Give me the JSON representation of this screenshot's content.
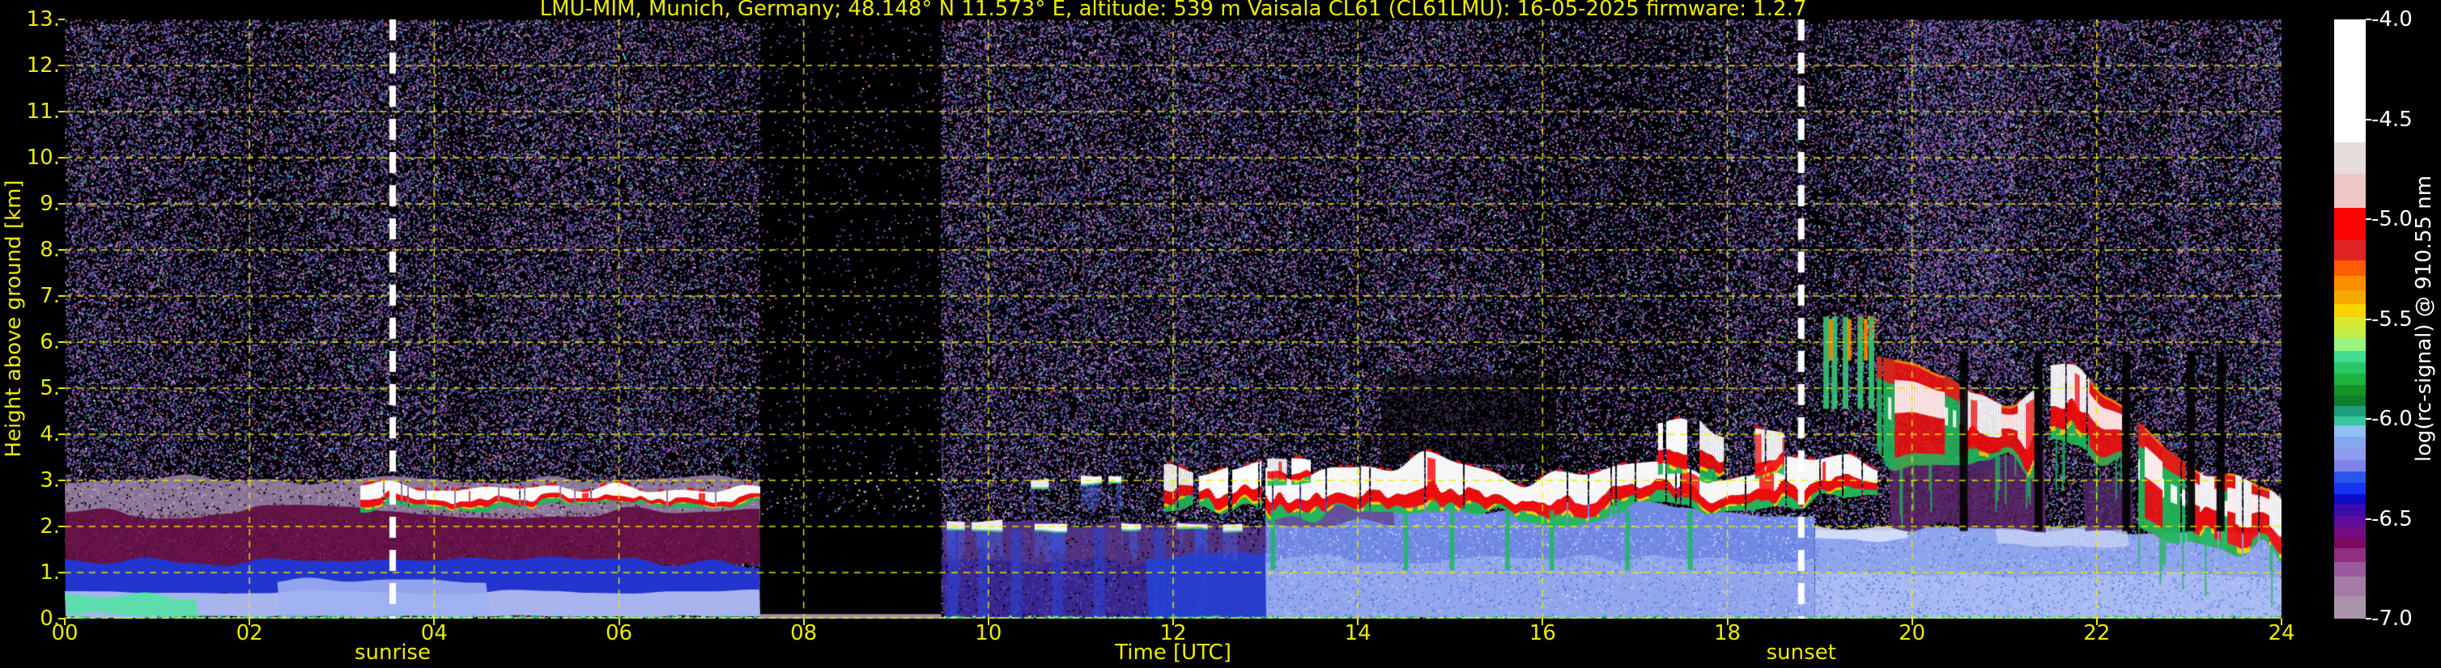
{
  "chart_data": {
    "type": "heatmap",
    "title": "LMU-MIM, Munich, Germany; 48.148° N 11.573° E, altitude: 539 m    Vaisala CL61 (CL61LMU): 16-05-2025    firmware: 1.2.7",
    "xlabel": "Time [UTC]",
    "ylabel": "Height above ground [km]",
    "colorbar_label": "log(rc-signal) @ 910.55 nm",
    "x_range_hours": [
      0,
      24
    ],
    "y_range_km": [
      0,
      13
    ],
    "grid": true,
    "x_ticks": [
      "00",
      "02",
      "04",
      "06",
      "08",
      "10",
      "12",
      "14",
      "16",
      "18",
      "20",
      "22",
      "24"
    ],
    "y_ticks": [
      "0.",
      "1.",
      "2.",
      "3.",
      "4.",
      "5.",
      "6.",
      "7.",
      "8.",
      "9.",
      "10.",
      "11.",
      "12.",
      "13."
    ],
    "colorbar_range": [
      -4.0,
      -7.0
    ],
    "colorbar_ticks": [
      {
        "v": -4.0,
        "label": "-4.0"
      },
      {
        "v": -4.5,
        "label": "-4.5"
      },
      {
        "v": -5.0,
        "label": "-5.0"
      },
      {
        "v": -5.5,
        "label": "-5.5"
      },
      {
        "v": -6.0,
        "label": "-6.0"
      },
      {
        "v": -6.5,
        "label": "-6.5"
      },
      {
        "v": -7.0,
        "label": "-7.0"
      }
    ],
    "colorbar_stops": [
      [
        0.0,
        0.205,
        "#ffffff"
      ],
      [
        0.205,
        0.258,
        "#e7dcdc"
      ],
      [
        0.258,
        0.315,
        "#eec6c6"
      ],
      [
        0.315,
        0.368,
        "#fb0404"
      ],
      [
        0.368,
        0.402,
        "#df2424"
      ],
      [
        0.402,
        0.428,
        "#fd5b04"
      ],
      [
        0.428,
        0.452,
        "#fb8d00"
      ],
      [
        0.452,
        0.475,
        "#f8a802"
      ],
      [
        0.475,
        0.497,
        "#fbd400"
      ],
      [
        0.497,
        0.516,
        "#d9e832"
      ],
      [
        0.516,
        0.532,
        "#c2ee45"
      ],
      [
        0.532,
        0.553,
        "#98f47e"
      ],
      [
        0.553,
        0.572,
        "#43dd92"
      ],
      [
        0.572,
        0.591,
        "#2bc767"
      ],
      [
        0.591,
        0.61,
        "#1cb23b"
      ],
      [
        0.61,
        0.628,
        "#139426"
      ],
      [
        0.628,
        0.645,
        "#0c7e2c"
      ],
      [
        0.645,
        0.662,
        "#1d9d80"
      ],
      [
        0.662,
        0.677,
        "#36c79b"
      ],
      [
        0.677,
        0.697,
        "#8fc1f2"
      ],
      [
        0.697,
        0.716,
        "#84a8f0"
      ],
      [
        0.716,
        0.735,
        "#8f9bee"
      ],
      [
        0.735,
        0.754,
        "#7e83ea"
      ],
      [
        0.754,
        0.773,
        "#2b58e8"
      ],
      [
        0.773,
        0.792,
        "#1635f2"
      ],
      [
        0.792,
        0.81,
        "#0d0dc8"
      ],
      [
        0.81,
        0.828,
        "#3c0cab"
      ],
      [
        0.828,
        0.846,
        "#5c0d9b"
      ],
      [
        0.846,
        0.864,
        "#740c86"
      ],
      [
        0.864,
        0.882,
        "#7c0a62"
      ],
      [
        0.882,
        0.905,
        "#8f2f84"
      ],
      [
        0.905,
        0.93,
        "#9a5a9e"
      ],
      [
        0.93,
        0.962,
        "#a37ca6"
      ],
      [
        0.962,
        1.0,
        "#ab93ab"
      ]
    ],
    "annotations": {
      "sunrise": {
        "label": "sunrise",
        "hour": 3.55
      },
      "sunset": {
        "label": "sunset",
        "hour": 18.8
      }
    },
    "data_gap_hours": [
      7.53,
      9.49
    ],
    "accent_colors": {
      "axis_yellow": "#ebeb00",
      "tick_white": "#ffffff",
      "background": "#000000"
    },
    "palettes": {
      "bg": [
        [
          "#6f4a9e",
          6
        ],
        [
          "#9b76b6",
          5
        ],
        [
          "#4f3a98",
          4
        ],
        [
          "#3a56d2",
          2
        ],
        [
          "#b494d0",
          2
        ],
        [
          "#d06ab2",
          1
        ],
        [
          "#2fb3a2",
          0.6
        ],
        [
          "#45c8e8",
          0.5
        ],
        [
          "#c23a52",
          0.5
        ],
        [
          "#22a050",
          0.5
        ],
        [
          "#e0e0e0",
          0.3
        ]
      ],
      "mauve": [
        [
          "#a890a8",
          5
        ],
        [
          "#8a6f92",
          3
        ],
        [
          "#000000",
          2
        ],
        [
          "#c9b4cc",
          1
        ]
      ],
      "maroon": [
        [
          "#6e1a50",
          4
        ],
        [
          "#4f1038",
          3
        ],
        [
          "#8a2a62",
          2
        ],
        [
          "#3a1030",
          1
        ]
      ],
      "purpleblue": [
        [
          "#4a2f96",
          4
        ],
        [
          "#5c3a8a",
          3
        ],
        [
          "#2a46d8",
          2
        ],
        [
          "#000000",
          1.5
        ],
        [
          "#7a55aa",
          1
        ]
      ],
      "blues": [
        [
          "#8fa5ec",
          4
        ],
        [
          "#6f8ae6",
          3
        ],
        [
          "#aabbf2",
          2
        ],
        [
          "#5570dd",
          1.5
        ],
        [
          "#c8d4f8",
          1
        ]
      ],
      "white": [
        [
          "#ffffff",
          1
        ]
      ],
      "warm": [
        [
          "#fc8c00",
          3
        ],
        [
          "#fb3a00",
          2
        ],
        [
          "#fcd200",
          1
        ]
      ]
    },
    "scene": [
      {
        "type": "noise",
        "t": [
          0,
          24
        ],
        "h": [
          0,
          13
        ],
        "d": 0.42,
        "pal": "bg",
        "s": 1
      },
      {
        "type": "wband",
        "t": [
          0,
          7.53
        ],
        "h": [
          2.15,
          3.02
        ],
        "amp": 0.12,
        "color": "#967fa3",
        "alpha": 0.9,
        "s": 11
      },
      {
        "type": "noise",
        "t": [
          0,
          7.53
        ],
        "h": [
          2.2,
          3.0
        ],
        "d": 0.25,
        "pal": "mauve",
        "s": 12
      },
      {
        "type": "wband",
        "t": [
          0,
          7.53
        ],
        "h": [
          1.12,
          2.32
        ],
        "amp": 0.16,
        "color": "#651247",
        "alpha": 1,
        "s": 13
      },
      {
        "type": "noise",
        "t": [
          0,
          7.53
        ],
        "h": [
          1.15,
          2.3
        ],
        "d": 0.18,
        "pal": "maroon",
        "s": 14
      },
      {
        "type": "wband",
        "t": [
          0,
          7.53
        ],
        "h": [
          0.5,
          1.22
        ],
        "amp": 0.14,
        "color": "#2335cf",
        "alpha": 1,
        "s": 15
      },
      {
        "type": "wband",
        "t": [
          0,
          7.53
        ],
        "h": [
          0.05,
          0.58
        ],
        "amp": 0.06,
        "color": "#a7b4ee",
        "alpha": 1,
        "s": 16
      },
      {
        "type": "wband",
        "t": [
          0,
          1.45
        ],
        "h": [
          0.12,
          0.5
        ],
        "amp": 0.14,
        "color": "#58dfa7",
        "alpha": 0.95,
        "s": 17
      },
      {
        "type": "wband",
        "t": [
          2.3,
          4.6
        ],
        "h": [
          0.05,
          0.85
        ],
        "amp": 0.1,
        "color": "#9fb0ef",
        "alpha": 0.9,
        "s": 18
      },
      {
        "type": "cloud",
        "t": [
          3.2,
          7.53
        ],
        "hb": [
          2.42,
          2.5
        ],
        "ht": [
          2.92,
          2.88
        ],
        "jag": 0.22,
        "und": 0.08,
        "drop": 0.05,
        "mode": "cumulus",
        "s": 21
      },
      {
        "type": "fill",
        "t": [
          7.53,
          9.49
        ],
        "h": [
          0,
          13
        ],
        "color": "#000000",
        "alpha": 1
      },
      {
        "type": "noise",
        "t": [
          7.53,
          9.49
        ],
        "h": [
          2.2,
          13
        ],
        "d": 0.03,
        "pal": "bg",
        "s": 22
      },
      {
        "type": "noise",
        "t": [
          7.6,
          9.45
        ],
        "h": [
          2.4,
          3.2
        ],
        "d": 0.012,
        "pal": "white",
        "s": 23
      },
      {
        "type": "fill",
        "t": [
          7.53,
          9.49
        ],
        "h": [
          0,
          0.1
        ],
        "color": "#a393a3",
        "alpha": 1
      },
      {
        "type": "wband",
        "t": [
          9.49,
          13.05
        ],
        "h": [
          0,
          1.3
        ],
        "amp": 0.08,
        "color": "#37258f",
        "alpha": 1,
        "s": 24
      },
      {
        "type": "wband",
        "t": [
          9.49,
          13.05
        ],
        "h": [
          1.25,
          2.02
        ],
        "amp": 0.12,
        "color": "#55337f",
        "alpha": 0.95,
        "s": 25
      },
      {
        "type": "noise",
        "t": [
          9.49,
          13.05
        ],
        "h": [
          0,
          2.0
        ],
        "d": 0.3,
        "pal": "purpleblue",
        "s": 26
      },
      {
        "type": "vstreaks",
        "ts": [
          9.62,
          9.95,
          10.3,
          10.75,
          11.2,
          11.85,
          12.3
        ],
        "h": [
          0,
          1.95
        ],
        "w": 14,
        "color": "#2a46d8",
        "alpha": 0.55
      },
      {
        "type": "wband",
        "t": [
          11.7,
          13.05
        ],
        "h": [
          0,
          1.35
        ],
        "amp": 0.1,
        "color": "#2741d2",
        "alpha": 0.9,
        "s": 27
      },
      {
        "type": "cloudsegs",
        "segs": [
          [
            9.55,
            9.74
          ],
          [
            9.82,
            10.14
          ],
          [
            10.5,
            10.84
          ],
          [
            11.44,
            11.64
          ],
          [
            12.04,
            12.36
          ],
          [
            12.54,
            12.74
          ]
        ],
        "hb": [
          1.92,
          1.92
        ],
        "ht": [
          2.12,
          2.12
        ],
        "jag": 0.1,
        "und": 0.04,
        "drop": 0,
        "mode": "cap",
        "s": 28
      },
      {
        "type": "cloudsegs",
        "segs": [
          [
            10.46,
            10.64
          ],
          [
            11.0,
            11.22
          ],
          [
            11.3,
            11.44
          ],
          [
            12.42,
            12.52
          ]
        ],
        "hb": [
          2.88,
          2.88
        ],
        "ht": [
          3.08,
          3.08
        ],
        "jag": 0.1,
        "und": 0.05,
        "drop": 0,
        "mode": "cap",
        "s": 29
      },
      {
        "type": "cloudsegs",
        "segs": [
          [
            11.9,
            12.2
          ],
          [
            12.28,
            12.58
          ],
          [
            12.64,
            12.95
          ]
        ],
        "hb": [
          2.35,
          2.4
        ],
        "ht": [
          3.2,
          3.25
        ],
        "jag": 0.3,
        "und": 0.1,
        "drop": 0.04,
        "mode": "cumulus",
        "s": 30
      },
      {
        "type": "wband",
        "t": [
          13.0,
          18.95
        ],
        "h": [
          0,
          1.4
        ],
        "amp": 0.08,
        "color": "#93a7ec",
        "alpha": 1,
        "s": 31
      },
      {
        "type": "wband",
        "t": [
          13.0,
          18.95
        ],
        "h": [
          1.3,
          2.38
        ],
        "amp": 0.18,
        "color": "#7289e4",
        "alpha": 1,
        "s": 32
      },
      {
        "type": "noise",
        "t": [
          13.0,
          18.95
        ],
        "h": [
          0,
          2.3
        ],
        "d": 0.22,
        "pal": "blues",
        "s": 33
      },
      {
        "type": "wband",
        "t": [
          13.0,
          14.4
        ],
        "h": [
          2.1,
          2.75
        ],
        "amp": 0.2,
        "color": "#5c3a7a",
        "alpha": 0.7,
        "s": 34
      },
      {
        "type": "fill",
        "t": [
          14.25,
          16.15
        ],
        "h": [
          3.35,
          5.3
        ],
        "color": "#000000",
        "alpha": 0.55
      },
      {
        "type": "cloud",
        "t": [
          13.0,
          19.62
        ],
        "hb": [
          2.3,
          2.5
        ],
        "ht": [
          3.2,
          3.3
        ],
        "jag": 0.5,
        "und": 0.35,
        "drop": 0.04,
        "mode": "cumulus",
        "s": 35
      },
      {
        "type": "cloudsegs",
        "segs": [
          [
            17.25,
            17.55
          ],
          [
            17.7,
            17.95
          ],
          [
            18.3,
            18.6
          ]
        ],
        "hb": [
          3.0,
          3.0
        ],
        "ht": [
          4.15,
          4.0
        ],
        "jag": 0.35,
        "und": 0.15,
        "drop": 0.03,
        "mode": "cumulus",
        "s": 36
      },
      {
        "type": "cloudsegs",
        "segs": [
          [
            13.02,
            13.22
          ],
          [
            13.28,
            13.48
          ]
        ],
        "hb": [
          2.9,
          2.9
        ],
        "ht": [
          3.42,
          3.4
        ],
        "jag": 0.2,
        "und": 0.08,
        "drop": 0,
        "mode": "cumulus",
        "s": 37
      },
      {
        "type": "vstreaks",
        "ts": [
          13.08,
          14.52,
          15.02,
          15.62,
          16.1,
          16.92,
          17.6
        ],
        "h": [
          1.05,
          2.35
        ],
        "w": 6,
        "color": "#21b565",
        "alpha": 0.85
      },
      {
        "type": "wband",
        "t": [
          18.95,
          24
        ],
        "h": [
          0,
          1.92
        ],
        "amp": 0.1,
        "color": "#8fa5ec",
        "alpha": 1,
        "s": 38
      },
      {
        "type": "wband",
        "t": [
          18.95,
          24
        ],
        "h": [
          0,
          0.95
        ],
        "amp": 0.06,
        "color": "#a9bbf2",
        "alpha": 1,
        "s": 39
      },
      {
        "type": "noise",
        "t": [
          18.95,
          24
        ],
        "h": [
          0,
          1.9
        ],
        "d": 0.2,
        "pal": "blues",
        "s": 40
      },
      {
        "type": "wband",
        "t": [
          18.95,
          19.95
        ],
        "h": [
          1.72,
          2.02
        ],
        "amp": 0.1,
        "color": "#dde5fa",
        "alpha": 0.85,
        "s": 41
      },
      {
        "type": "wband",
        "t": [
          20.9,
          22.35
        ],
        "h": [
          1.6,
          1.95
        ],
        "amp": 0.12,
        "color": "#cdd9f7",
        "alpha": 0.7,
        "s": 42
      },
      {
        "type": "wband",
        "t": [
          19.75,
          21.45
        ],
        "h": [
          2.0,
          3.42
        ],
        "amp": 0.3,
        "color": "#54296b",
        "alpha": 0.9,
        "s": 43
      },
      {
        "type": "noise",
        "t": [
          19.75,
          21.45
        ],
        "h": [
          2.0,
          3.3
        ],
        "d": 0.22,
        "pal": "maroon",
        "s": 51
      },
      {
        "type": "wband",
        "t": [
          21.85,
          22.4
        ],
        "h": [
          1.95,
          2.9
        ],
        "amp": 0.2,
        "color": "#54296b",
        "alpha": 0.8,
        "s": 44
      },
      {
        "type": "noise",
        "t": [
          19.9,
          21.1
        ],
        "h": [
          5.2,
          13
        ],
        "d": 0.22,
        "pal": "bg",
        "s": 60
      },
      {
        "type": "noise",
        "t": [
          22.8,
          24
        ],
        "h": [
          3.0,
          13
        ],
        "d": 0.18,
        "pal": "bg",
        "s": 61
      },
      {
        "type": "vstreaks",
        "ts": [
          19.07,
          19.16,
          19.28,
          19.44,
          19.56
        ],
        "h": [
          4.55,
          6.55
        ],
        "w": 7,
        "color": "#35c878",
        "alpha": 0.9
      },
      {
        "type": "vstreaks",
        "ts": [
          19.12,
          19.32,
          19.5
        ],
        "h": [
          5.6,
          6.5
        ],
        "w": 5,
        "color": "#fc8c00",
        "alpha": 0.9
      },
      {
        "type": "noise",
        "t": [
          19.4,
          19.65
        ],
        "h": [
          6.1,
          6.6
        ],
        "d": 0.2,
        "pal": "warm",
        "s": 45
      },
      {
        "type": "cloud",
        "t": [
          19.62,
          21.32
        ],
        "hb": [
          3.45,
          3.35
        ],
        "ht": [
          5.5,
          5.2
        ],
        "jag": 0.8,
        "und": 0.5,
        "drop": 0.03,
        "mode": "storm",
        "s": 46
      },
      {
        "type": "cloud",
        "t": [
          21.5,
          22.27
        ],
        "hb": [
          3.55,
          3.3
        ],
        "ht": [
          5.15,
          4.7
        ],
        "jag": 0.6,
        "und": 0.4,
        "drop": 0.05,
        "mode": "storm",
        "s": 47
      },
      {
        "type": "cloud",
        "t": [
          22.45,
          24.0
        ],
        "hb": [
          2.1,
          1.55
        ],
        "ht": [
          4.35,
          2.9
        ],
        "jag": 0.7,
        "und": 0.4,
        "drop": 0.08,
        "mode": "storm",
        "s": 48
      },
      {
        "type": "vstreaks",
        "ts": [
          20.56,
          21.37,
          22.32,
          23.02,
          23.34
        ],
        "h": [
          1.9,
          5.8
        ],
        "w": 10,
        "color": "#000000",
        "alpha": 0.9
      },
      {
        "type": "surface",
        "t": [
          0,
          7.53
        ]
      },
      {
        "type": "surface",
        "t": [
          9.49,
          24
        ]
      }
    ]
  }
}
